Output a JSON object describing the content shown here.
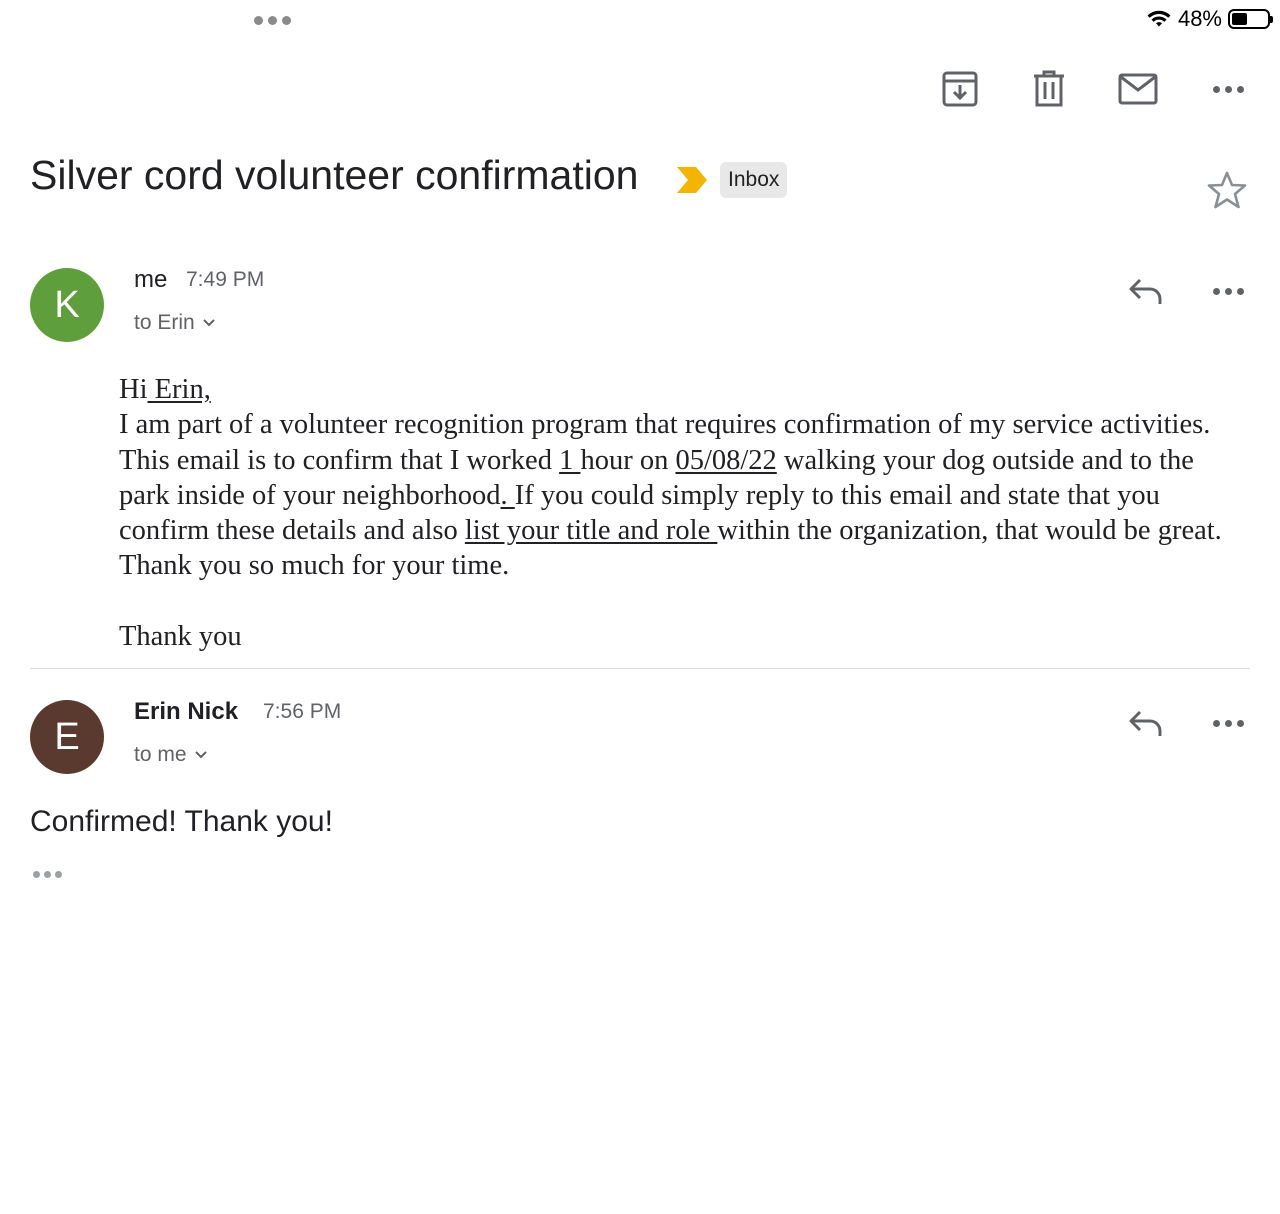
{
  "status_bar": {
    "battery_text": "48%"
  },
  "toolbar": {
    "archive_icon": "archive-icon",
    "delete_icon": "trash-icon",
    "mark_unread_icon": "mail-icon",
    "more_icon": "more-horiz-icon"
  },
  "thread": {
    "subject": "Silver cord volunteer confirmation",
    "label_chip": "Inbox",
    "important_color": "#F4B400"
  },
  "messages": [
    {
      "avatar_letter": "K",
      "avatar_color": "#5E9F3B",
      "sender": "me",
      "time": "7:49 PM",
      "recipient": "to Erin",
      "greeting_prefix": "Hi",
      "greeting_name": " Erin,",
      "body_1": "I am part of a volunteer recognition program that requires confirmation of my service activities. This email is to confirm that I worked ",
      "hours": "1 ",
      "body_2": "hour on ",
      "date": "05/08/22",
      "body_3": " walking your dog outside and to the park inside of your neighborhood",
      "period": ". ",
      "body_4": "If you could simply reply to this email and state that you confirm these details and also ",
      "title_role": "list your title and role ",
      "body_5": "within the organization, that would be great. Thank you so much for your time.",
      "closing": "Thank you"
    },
    {
      "avatar_letter": "E",
      "avatar_color": "#5A3A2E",
      "sender": "Erin Nick",
      "time": "7:56 PM",
      "recipient": "to me",
      "body": "Confirmed! Thank you!"
    }
  ]
}
